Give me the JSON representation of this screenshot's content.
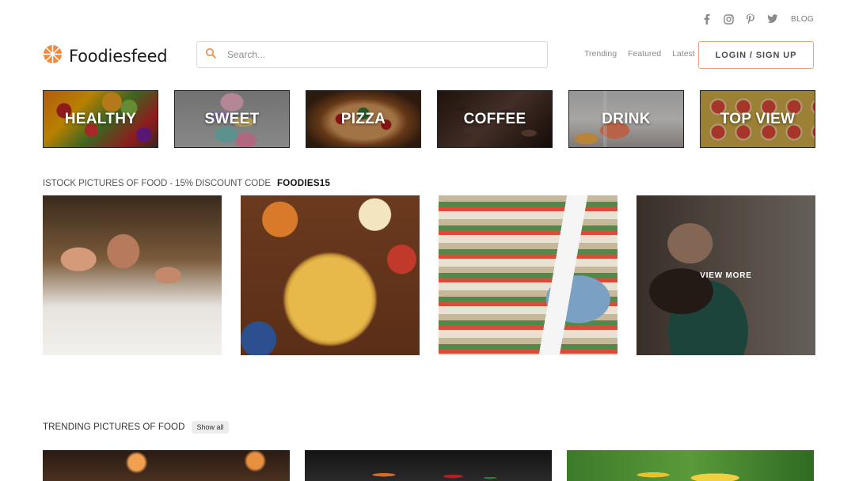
{
  "social": {
    "icons": [
      "facebook-icon",
      "instagram-icon",
      "pinterest-icon",
      "twitter-icon"
    ],
    "blog_label": "BLOG"
  },
  "header": {
    "logo_text": "Foodiesfeed",
    "search_placeholder": "Search...",
    "nav": [
      "Trending",
      "Featured",
      "Latest"
    ],
    "login_label": "LOGIN / SIGN UP",
    "accent_color": "#f08a3c"
  },
  "categories": [
    {
      "label": "HEALTHY"
    },
    {
      "label": "SWEET"
    },
    {
      "label": "PIZZA"
    },
    {
      "label": "COFFEE"
    },
    {
      "label": "DRINK"
    },
    {
      "label": "TOP VIEW"
    }
  ],
  "istock": {
    "title": "ISTOCK PICTURES OF FOOD - 15% DISCOUNT CODE",
    "code": "FOODIES15",
    "view_more": "VIEW MORE"
  },
  "trending": {
    "title": "TRENDING PICTURES OF FOOD",
    "show_all": "Show all"
  }
}
